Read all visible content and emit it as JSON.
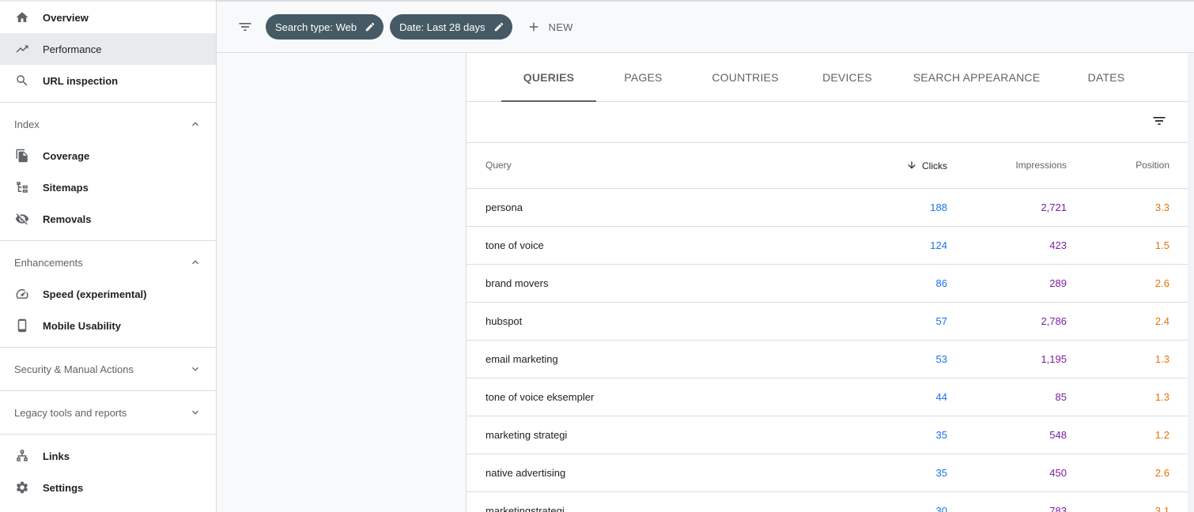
{
  "sidebar": {
    "top_items": [
      {
        "label": "Overview",
        "icon": "home-icon"
      },
      {
        "label": "Performance",
        "icon": "trending-up-icon",
        "active": true
      },
      {
        "label": "URL inspection",
        "icon": "search-icon"
      }
    ],
    "sections": {
      "index": {
        "title": "Index",
        "expanded": true,
        "items": [
          {
            "label": "Coverage",
            "icon": "file-copy-icon"
          },
          {
            "label": "Sitemaps",
            "icon": "sitemap-icon"
          },
          {
            "label": "Removals",
            "icon": "eye-off-icon"
          }
        ]
      },
      "enhancements": {
        "title": "Enhancements",
        "expanded": true,
        "items": [
          {
            "label": "Speed (experimental)",
            "icon": "speedometer-icon"
          },
          {
            "label": "Mobile Usability",
            "icon": "phone-icon"
          }
        ]
      },
      "security": {
        "title": "Security & Manual Actions",
        "expanded": false
      },
      "legacy": {
        "title": "Legacy tools and reports",
        "expanded": false
      }
    },
    "bottom_items": [
      {
        "label": "Links",
        "icon": "links-icon"
      },
      {
        "label": "Settings",
        "icon": "gear-icon"
      }
    ]
  },
  "topbar": {
    "chips": [
      {
        "label": "Search type: Web"
      },
      {
        "label": "Date: Last 28 days"
      }
    ],
    "new_label": "NEW"
  },
  "tabs": [
    {
      "label": "QUERIES",
      "active": true
    },
    {
      "label": "PAGES"
    },
    {
      "label": "COUNTRIES"
    },
    {
      "label": "DEVICES"
    },
    {
      "label": "SEARCH APPEARANCE"
    },
    {
      "label": "DATES"
    }
  ],
  "table": {
    "headers": {
      "query": "Query",
      "clicks": "Clicks",
      "impressions": "Impressions",
      "position": "Position"
    },
    "rows": [
      {
        "query": "persona",
        "clicks": "188",
        "impressions": "2,721",
        "position": "3.3"
      },
      {
        "query": "tone of voice",
        "clicks": "124",
        "impressions": "423",
        "position": "1.5"
      },
      {
        "query": "brand movers",
        "clicks": "86",
        "impressions": "289",
        "position": "2.6"
      },
      {
        "query": "hubspot",
        "clicks": "57",
        "impressions": "2,786",
        "position": "2.4"
      },
      {
        "query": "email marketing",
        "clicks": "53",
        "impressions": "1,195",
        "position": "1.3"
      },
      {
        "query": "tone of voice eksempler",
        "clicks": "44",
        "impressions": "85",
        "position": "1.3"
      },
      {
        "query": "marketing strategi",
        "clicks": "35",
        "impressions": "548",
        "position": "1.2"
      },
      {
        "query": "native advertising",
        "clicks": "35",
        "impressions": "450",
        "position": "2.6"
      },
      {
        "query": "marketingstrategi",
        "clicks": "30",
        "impressions": "783",
        "position": "3.1"
      }
    ]
  },
  "colors": {
    "clicks": "#1a73e8",
    "impressions": "#7b1fa2",
    "position": "#e8710a",
    "chip": "#455a64"
  }
}
